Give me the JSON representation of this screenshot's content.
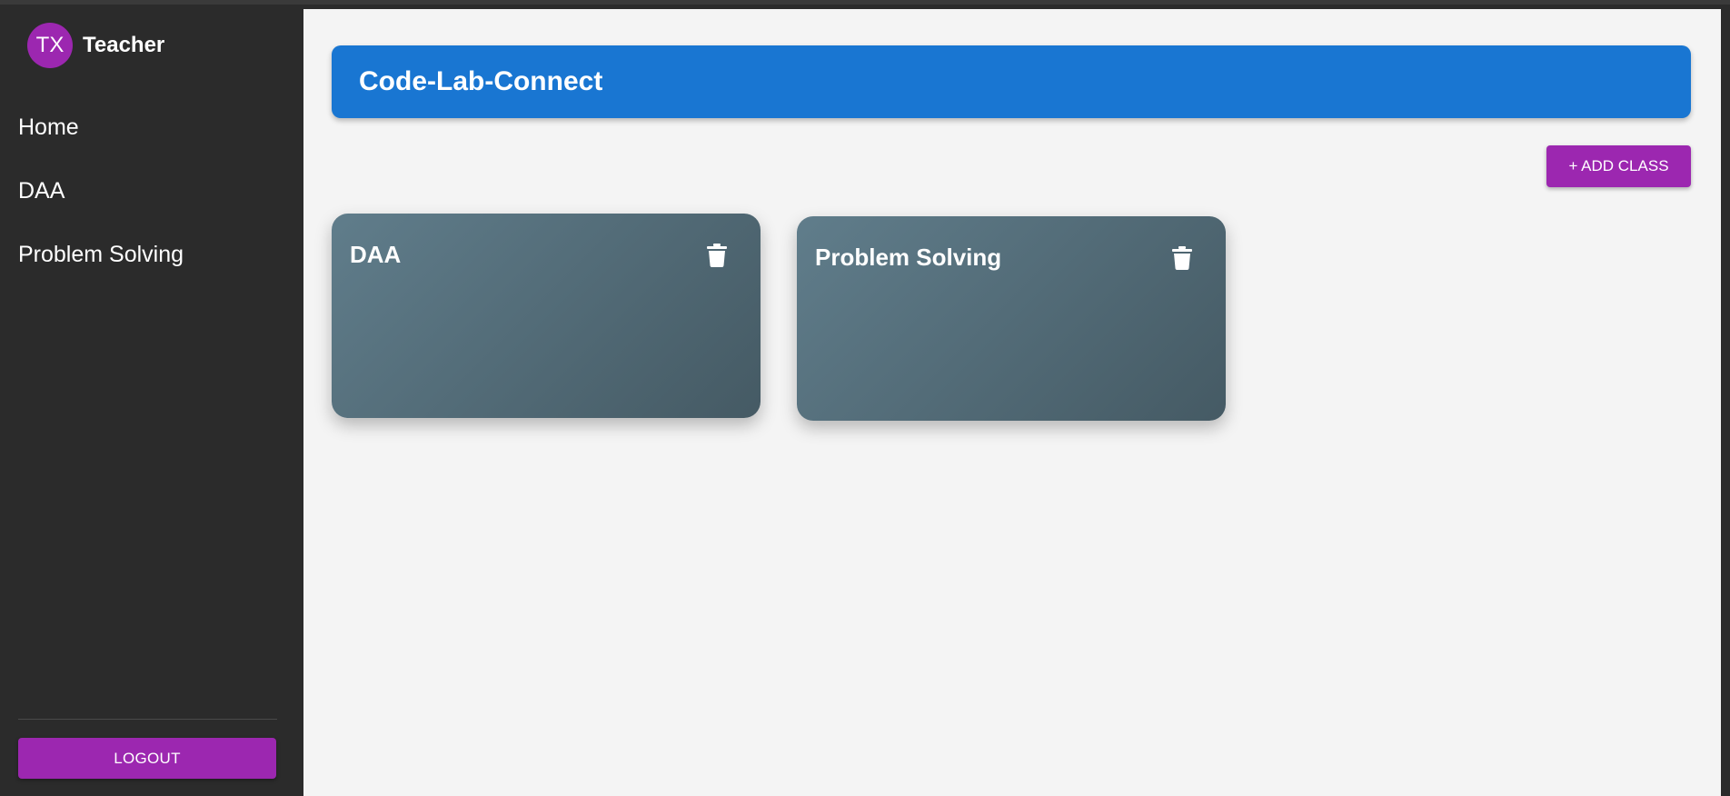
{
  "profile": {
    "avatar_initials": "TX",
    "name": "Teacher"
  },
  "sidebar": {
    "items": [
      {
        "label": "Home"
      },
      {
        "label": "DAA"
      },
      {
        "label": "Problem Solving"
      }
    ],
    "logout_label": "LOGOUT"
  },
  "header": {
    "title": "Code-Lab-Connect"
  },
  "toolbar": {
    "add_class_label": "+ ADD CLASS"
  },
  "classes": [
    {
      "name": "DAA",
      "delete_icon": "trash-icon"
    },
    {
      "name": "Problem Solving",
      "delete_icon": "trash-icon"
    }
  ],
  "colors": {
    "accent": "#9c27b0",
    "header": "#1976d2",
    "sidebar": "#2b2b2b",
    "card_gradient_start": "#607d8b",
    "card_gradient_end": "#455a64"
  }
}
